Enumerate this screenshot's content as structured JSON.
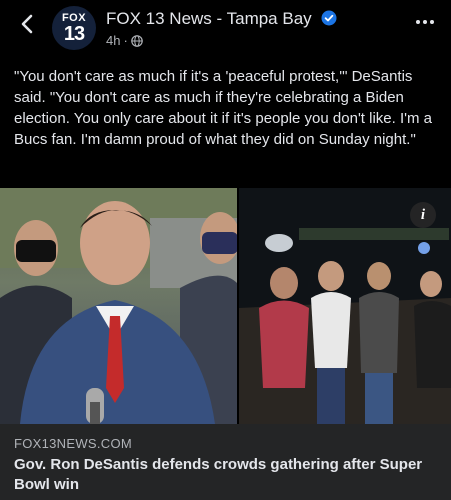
{
  "header": {
    "back_icon": "chevron-left-icon",
    "avatar": {
      "line1": "FOX",
      "line2": "13"
    },
    "page_name": "FOX 13 News - Tampa Bay",
    "verified_icon": "verified-badge-icon",
    "time": "4h",
    "separator": "·",
    "privacy_icon": "globe-icon",
    "more_icon": "more-dots-icon"
  },
  "post": {
    "caption": "\"You don't care as much if it's a 'peaceful protest,'\" DeSantis said. \"You don't care as much if they're celebrating a Biden election. You only care about it if it's people you don't like. I'm a Bucs fan. I'm damn proud of what they did on Sunday night.\""
  },
  "media": {
    "info_label": "i"
  },
  "link_card": {
    "domain": "FOX13NEWS.COM",
    "title": "Gov. Ron DeSantis defends crowds gathering after Super Bowl win"
  },
  "colors": {
    "background": "#000000",
    "text": "#e4e6eb",
    "muted": "#b0b3b8",
    "card": "#242526",
    "verified": "#1b74e4"
  }
}
